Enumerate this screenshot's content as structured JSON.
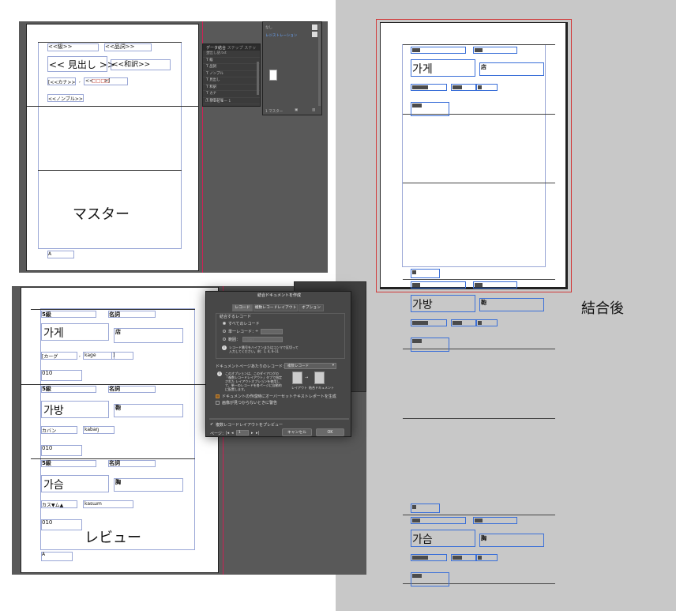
{
  "master": {
    "field_kyu": "<<級>>",
    "field_hinshi": "<<品詞>>",
    "field_midashi": "<< 見出し >>",
    "field_wayaku": "<<和訳>>",
    "field_kana": "[<<カナ>>",
    "field_sep": ",",
    "field_roma_prefix": "<<",
    "field_roma_red": "□□□□",
    "field_roma_suffix": ">]",
    "field_non": "<<ノンブル>>",
    "field_a": "A",
    "caption": "マスター"
  },
  "data_merge_panel": {
    "title": "データ結合",
    "tab2": "ステップ",
    "tab3": "ステップ",
    "source": "見出し語.txt",
    "rows": [
      "級",
      "品詞",
      "ノンブル",
      "見出し",
      "和訳",
      "カナ",
      "発音記号"
    ],
    "preview_label": "プレビュー",
    "page_nav": "1"
  },
  "swatch_panel": {
    "label1": "なし",
    "label2": "レジストレーション",
    "foot": "1 マスター"
  },
  "review": {
    "caption": "レビュー",
    "field_a": "A",
    "records": [
      {
        "kyu": "5級",
        "hinshi": "名詞",
        "headword": "가게",
        "meaning": "店",
        "kana": "[カーグ",
        "roma": "kage",
        "close": "]",
        "page": "010"
      },
      {
        "kyu": "5級",
        "hinshi": "名詞",
        "headword": "가방",
        "meaning": "鞄",
        "kana": "カバン",
        "roma": "kabaŋ",
        "close": "",
        "page": "010"
      },
      {
        "kyu": "5級",
        "hinshi": "名詞",
        "headword": "가슴",
        "meaning": "胸",
        "kana": "カス▼ム▲",
        "roma": "kasɯm",
        "close": "",
        "page": "010"
      }
    ]
  },
  "dialog": {
    "title": "結合ドキュメントを作成",
    "tab_record": "レコード",
    "tab_layout": "複数レコードレイアウト",
    "tab_options": "オプション",
    "group_label": "結合するレコード",
    "opt_all": "すべてのレコード",
    "opt_single": "単一レコード：",
    "opt_range": "範囲：",
    "range_placeholder": "1-3563",
    "range_note": "レコード番号をハイフンまたはコンマで区切って入力してください。例：1, 4, 6-11",
    "records_per_page_label": "ドキュメントページあたりのレコード：",
    "records_per_page_value": "複数レコード",
    "info_text": "このオプションは、このダイアログの「複数レコードレイアウト」タブで指定された レイアウトオプションを使用して、単一のレコードを各ページに自動的に配置します。",
    "layout_label": "レイアウト",
    "merged_label": "結合ドキュメント",
    "chk_overset": "ドキュメントの作成時にオーバーセットテキストレポートを生成",
    "chk_image": "画像が見つからないときに警告",
    "chk_preview": "複数レコードレイアウトをプレビュー",
    "page_label": "ページ：",
    "page_value": "1",
    "cancel_label": "キャンセル",
    "ok_label": "OK"
  },
  "merged": {
    "caption": "結合後",
    "records": [
      {
        "headword": "가게",
        "meaning": "店"
      },
      {
        "headword": "가방",
        "meaning": "鞄"
      },
      {
        "headword": "가슴",
        "meaning": "胸"
      }
    ]
  }
}
